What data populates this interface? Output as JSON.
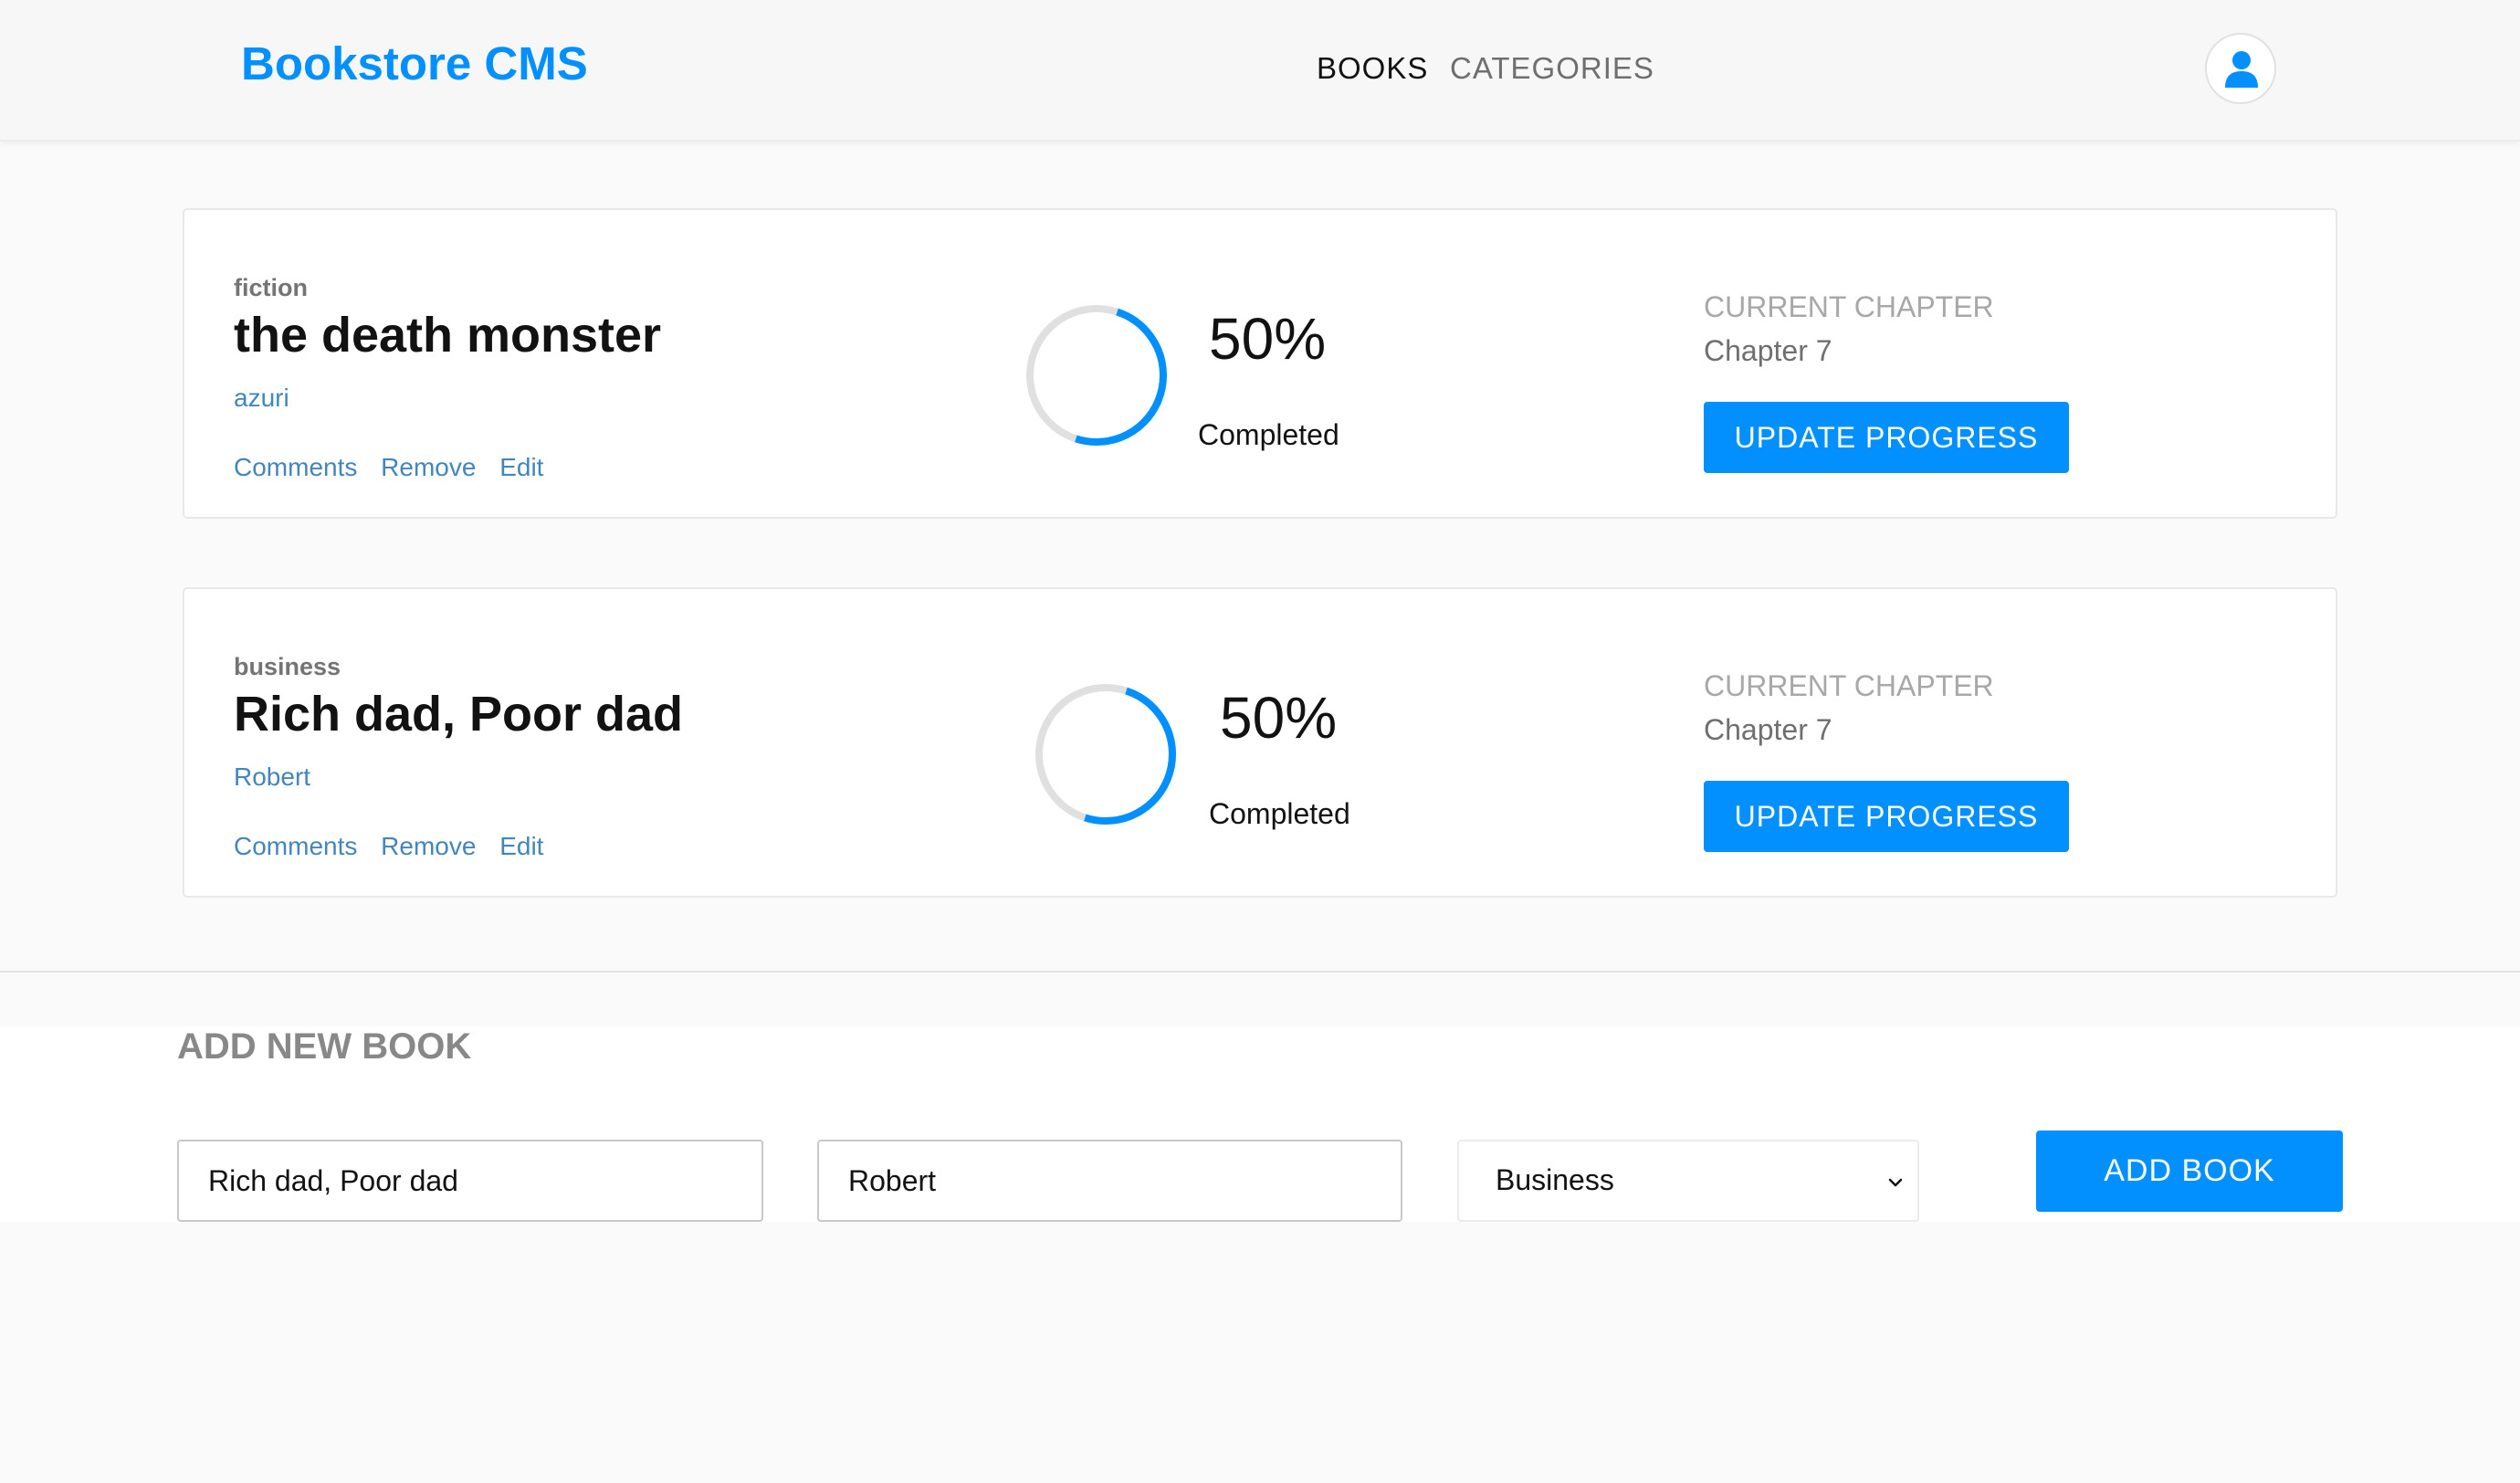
{
  "header": {
    "brand": "Bookstore CMS",
    "nav": {
      "books": "BOOKS",
      "categories": "CATEGORIES"
    },
    "avatar_icon": "user-icon"
  },
  "books": [
    {
      "category": "fiction",
      "title": "the death monster",
      "author": "azuri",
      "actions": {
        "comments": "Comments",
        "remove": "Remove",
        "edit": "Edit"
      },
      "progress_percent": 50,
      "percent_text": "50%",
      "completed_label": "Completed",
      "current_chapter_label": "CURRENT CHAPTER",
      "current_chapter": "Chapter 7",
      "update_button": "UPDATE PROGRESS"
    },
    {
      "category": "business",
      "title": "Rich dad, Poor dad",
      "author": "Robert",
      "actions": {
        "comments": "Comments",
        "remove": "Remove",
        "edit": "Edit"
      },
      "progress_percent": 50,
      "percent_text": "50%",
      "completed_label": "Completed",
      "current_chapter_label": "CURRENT CHAPTER",
      "current_chapter": "Chapter 7",
      "update_button": "UPDATE PROGRESS"
    }
  ],
  "form": {
    "heading": "ADD NEW BOOK",
    "title_value": "Rich dad, Poor dad",
    "author_value": "Robert",
    "category_selected": "Business",
    "submit": "ADD BOOK"
  },
  "colors": {
    "accent": "#0290ff",
    "link": "#4386bf",
    "ring_track": "#e0e0e0"
  }
}
